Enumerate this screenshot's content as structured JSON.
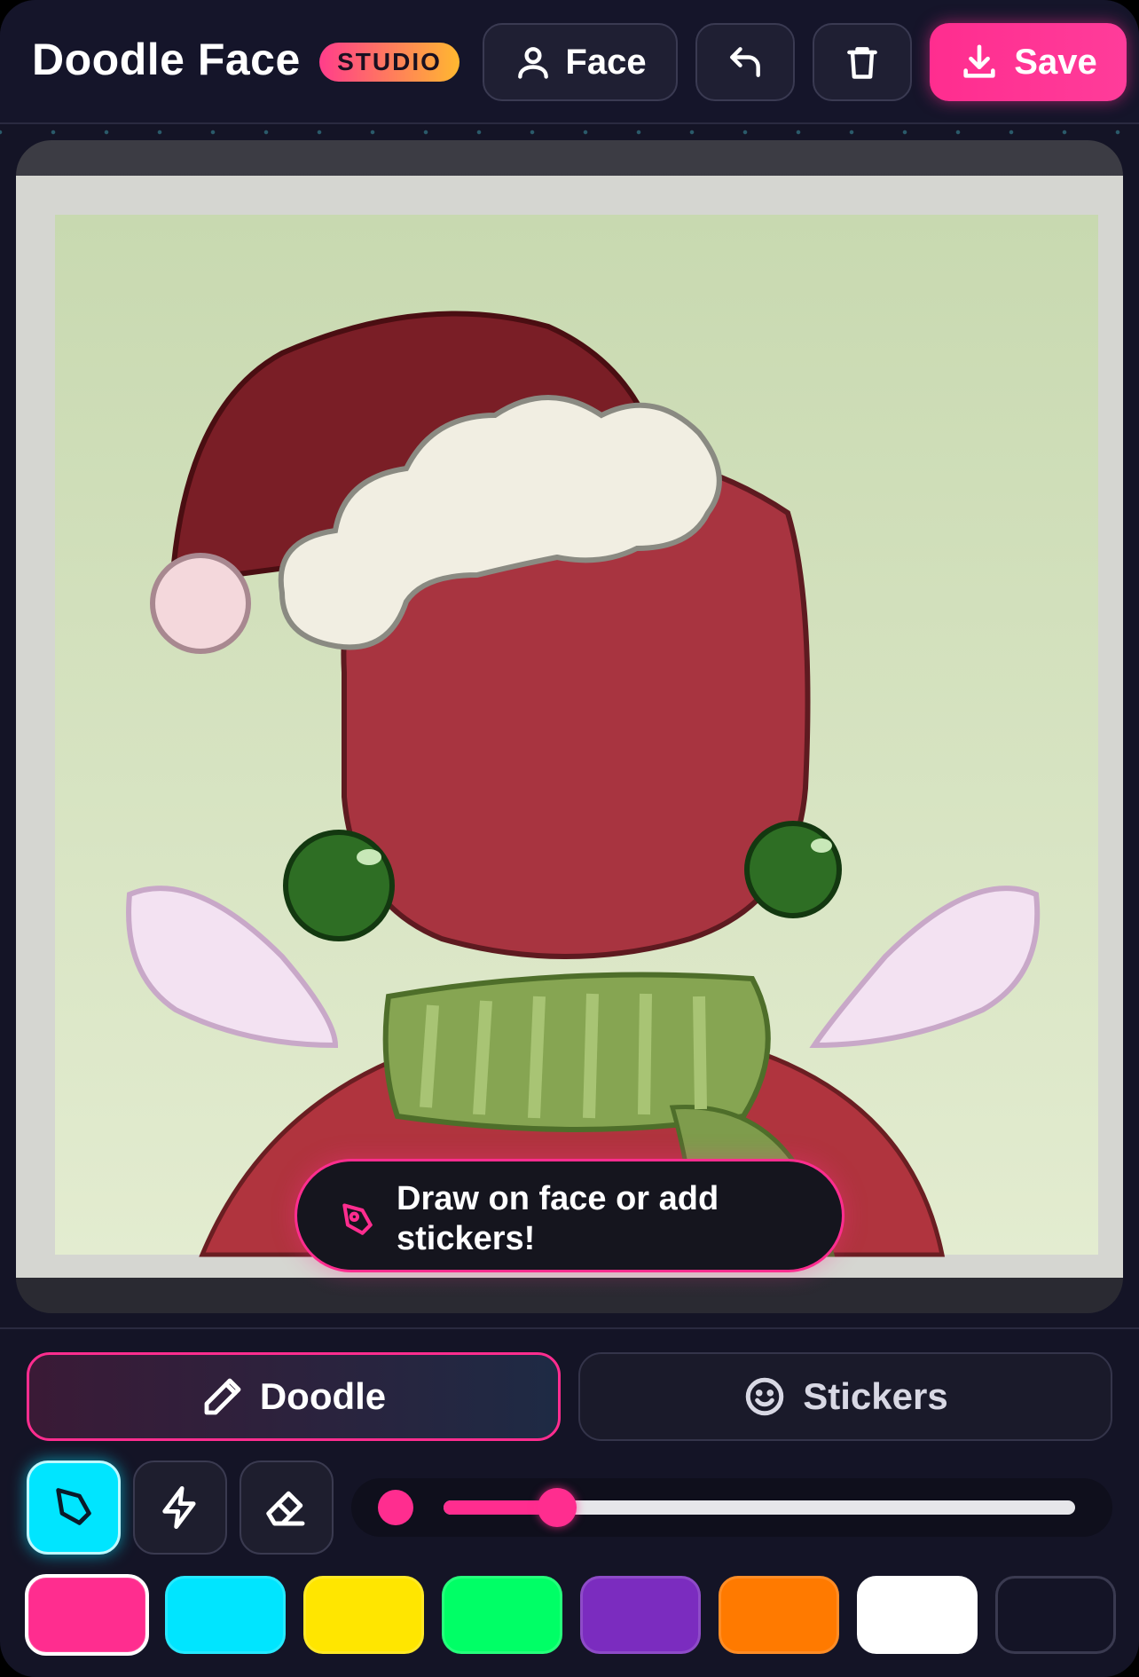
{
  "header": {
    "title": "Doodle Face",
    "badge": "STUDIO",
    "face_label": "Face",
    "save_label": "Save"
  },
  "canvas": {
    "hint": "Draw on face or add stickers!"
  },
  "tabs": [
    {
      "label": "Doodle",
      "active": true,
      "icon": "pencil-icon"
    },
    {
      "label": "Stickers",
      "active": false,
      "icon": "smiley-icon"
    }
  ],
  "tools": [
    {
      "name": "pen-tool",
      "icon": "pen-nib-icon",
      "active": true
    },
    {
      "name": "flash-tool",
      "icon": "lightning-icon",
      "active": false
    },
    {
      "name": "eraser-tool",
      "icon": "eraser-icon",
      "active": false
    }
  ],
  "brush": {
    "size_fraction": 0.18,
    "color": "#ff2d8f"
  },
  "palette": [
    {
      "color": "#ff2d8f",
      "selected": true
    },
    {
      "color": "#00e5ff",
      "selected": false
    },
    {
      "color": "#ffe600",
      "selected": false
    },
    {
      "color": "#00ff66",
      "selected": false
    },
    {
      "color": "#7b2cbf",
      "selected": false
    },
    {
      "color": "#ff7a00",
      "selected": false
    },
    {
      "color": "#ffffff",
      "selected": false
    },
    {
      "color": "#141426",
      "selected": false
    }
  ]
}
